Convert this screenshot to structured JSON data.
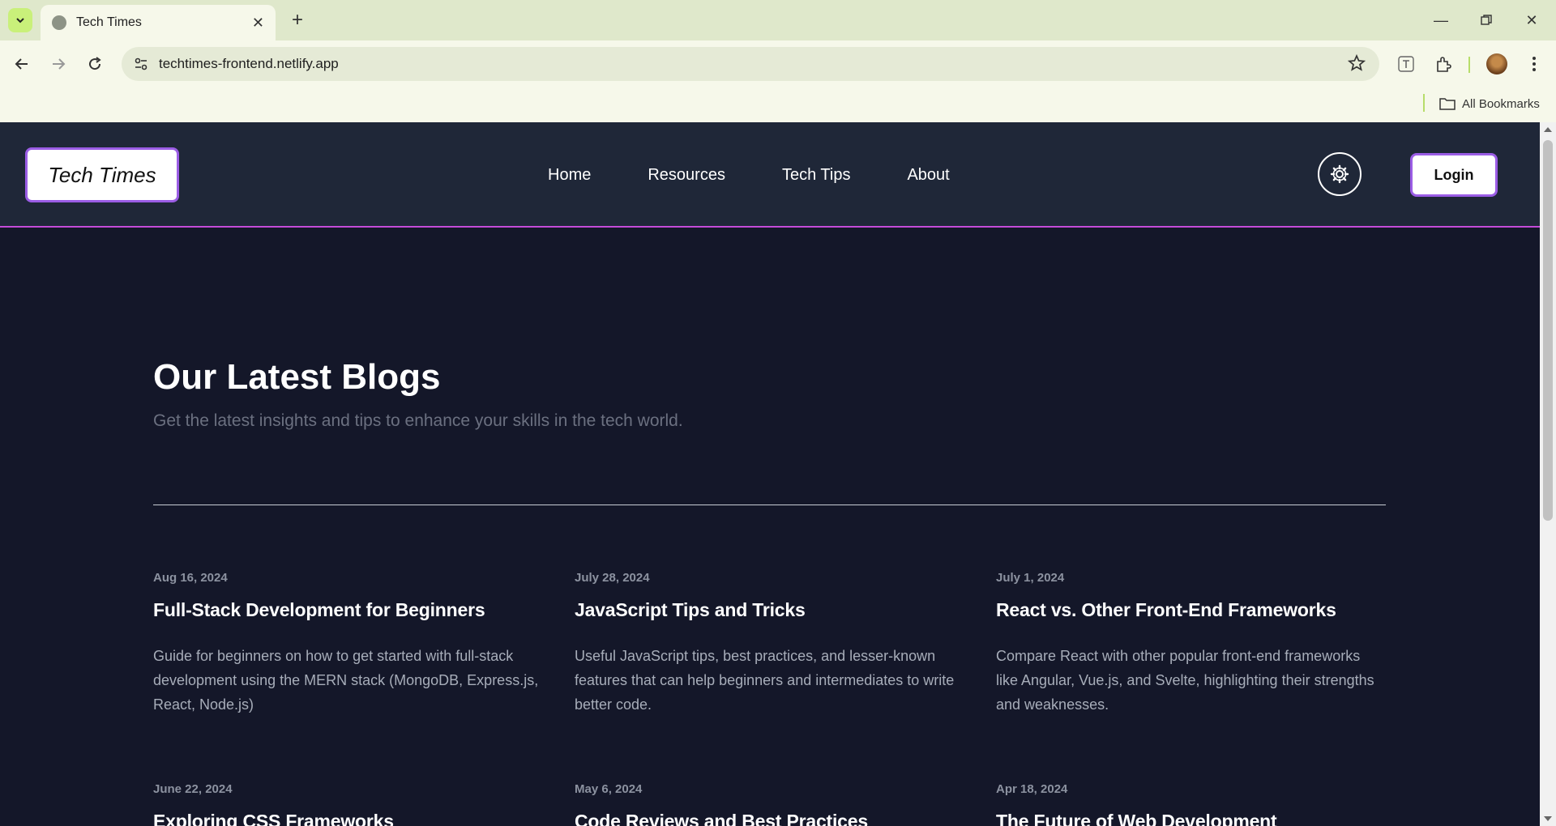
{
  "browser": {
    "tab_title": "Tech Times",
    "url": "techtimes-frontend.netlify.app",
    "bookmarks_label": "All Bookmarks"
  },
  "site": {
    "logo": "Tech Times",
    "nav": [
      "Home",
      "Resources",
      "Tech Tips",
      "About"
    ],
    "login": "Login",
    "hero_title": "Our Latest Blogs",
    "hero_subtitle": "Get the latest insights and tips to enhance your skills in the tech world.",
    "blogs": [
      {
        "date": "Aug 16, 2024",
        "title": "Full-Stack Development for Beginners",
        "desc": "Guide for beginners on how to get started with full-stack development using the MERN stack (MongoDB, Express.js, React, Node.js)"
      },
      {
        "date": "July 28, 2024",
        "title": "JavaScript Tips and Tricks",
        "desc": "Useful JavaScript tips, best practices, and lesser-known features that can help beginners and intermediates to write better code."
      },
      {
        "date": "July 1, 2024",
        "title": "React vs. Other Front-End Frameworks",
        "desc": "Compare React with other popular front-end frameworks like Angular, Vue.js, and Svelte, highlighting their strengths and weaknesses."
      },
      {
        "date": "June 22, 2024",
        "title": "Exploring CSS Frameworks",
        "desc": ""
      },
      {
        "date": "May 6, 2024",
        "title": "Code Reviews and Best Practices",
        "desc": ""
      },
      {
        "date": "Apr 18, 2024",
        "title": "The Future of Web Development",
        "desc": ""
      }
    ]
  },
  "colors": {
    "site_bg": "#141729",
    "header_bg": "#1f2738",
    "accent": "#9b5de5",
    "header_border": "#c44bd8"
  }
}
